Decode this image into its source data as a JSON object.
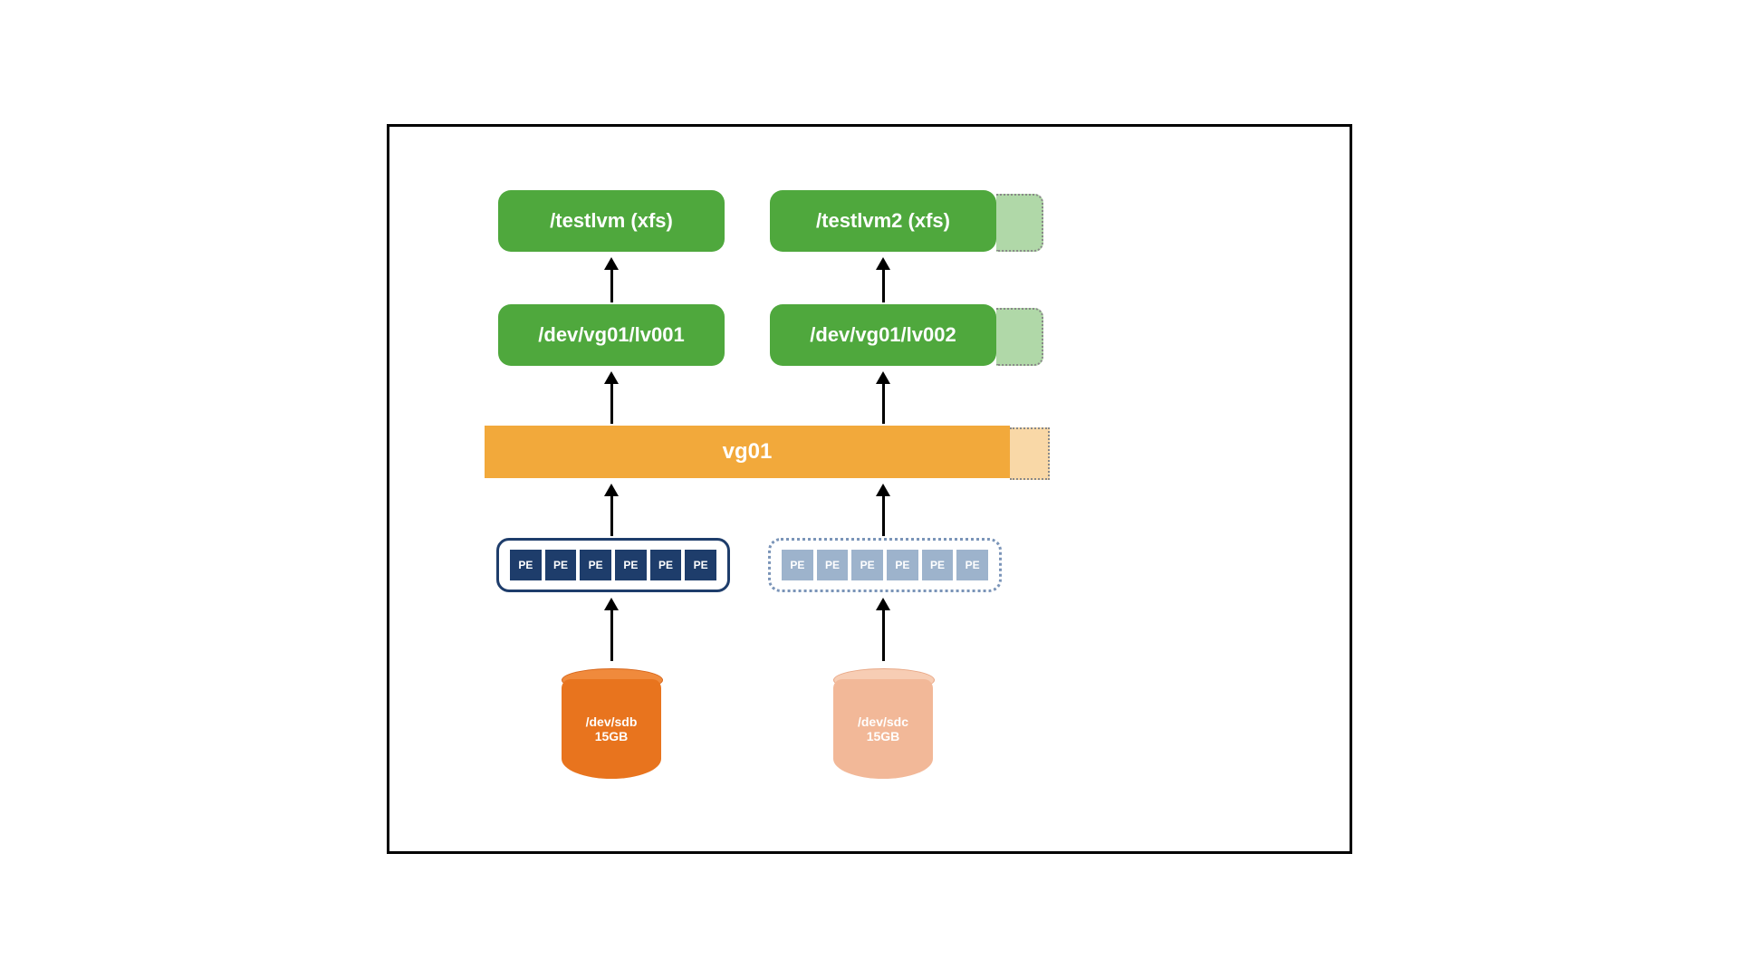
{
  "filesystems": {
    "left": "/testlvm (xfs)",
    "right": "/testlvm2 (xfs)"
  },
  "logical_volumes": {
    "left": "/dev/vg01/lv001",
    "right": "/dev/vg01/lv002"
  },
  "volume_group": "vg01",
  "pe_label": "PE",
  "disks": {
    "left": {
      "name": "/dev/sdb",
      "size": "15GB"
    },
    "right": {
      "name": "/dev/sdc",
      "size": "15GB"
    }
  },
  "colors": {
    "green": "#4fa83d",
    "orange": "#f2a93b",
    "navy": "#1e3d6b",
    "disk_primary": "#e8741e",
    "disk_secondary": "#f2b898"
  }
}
